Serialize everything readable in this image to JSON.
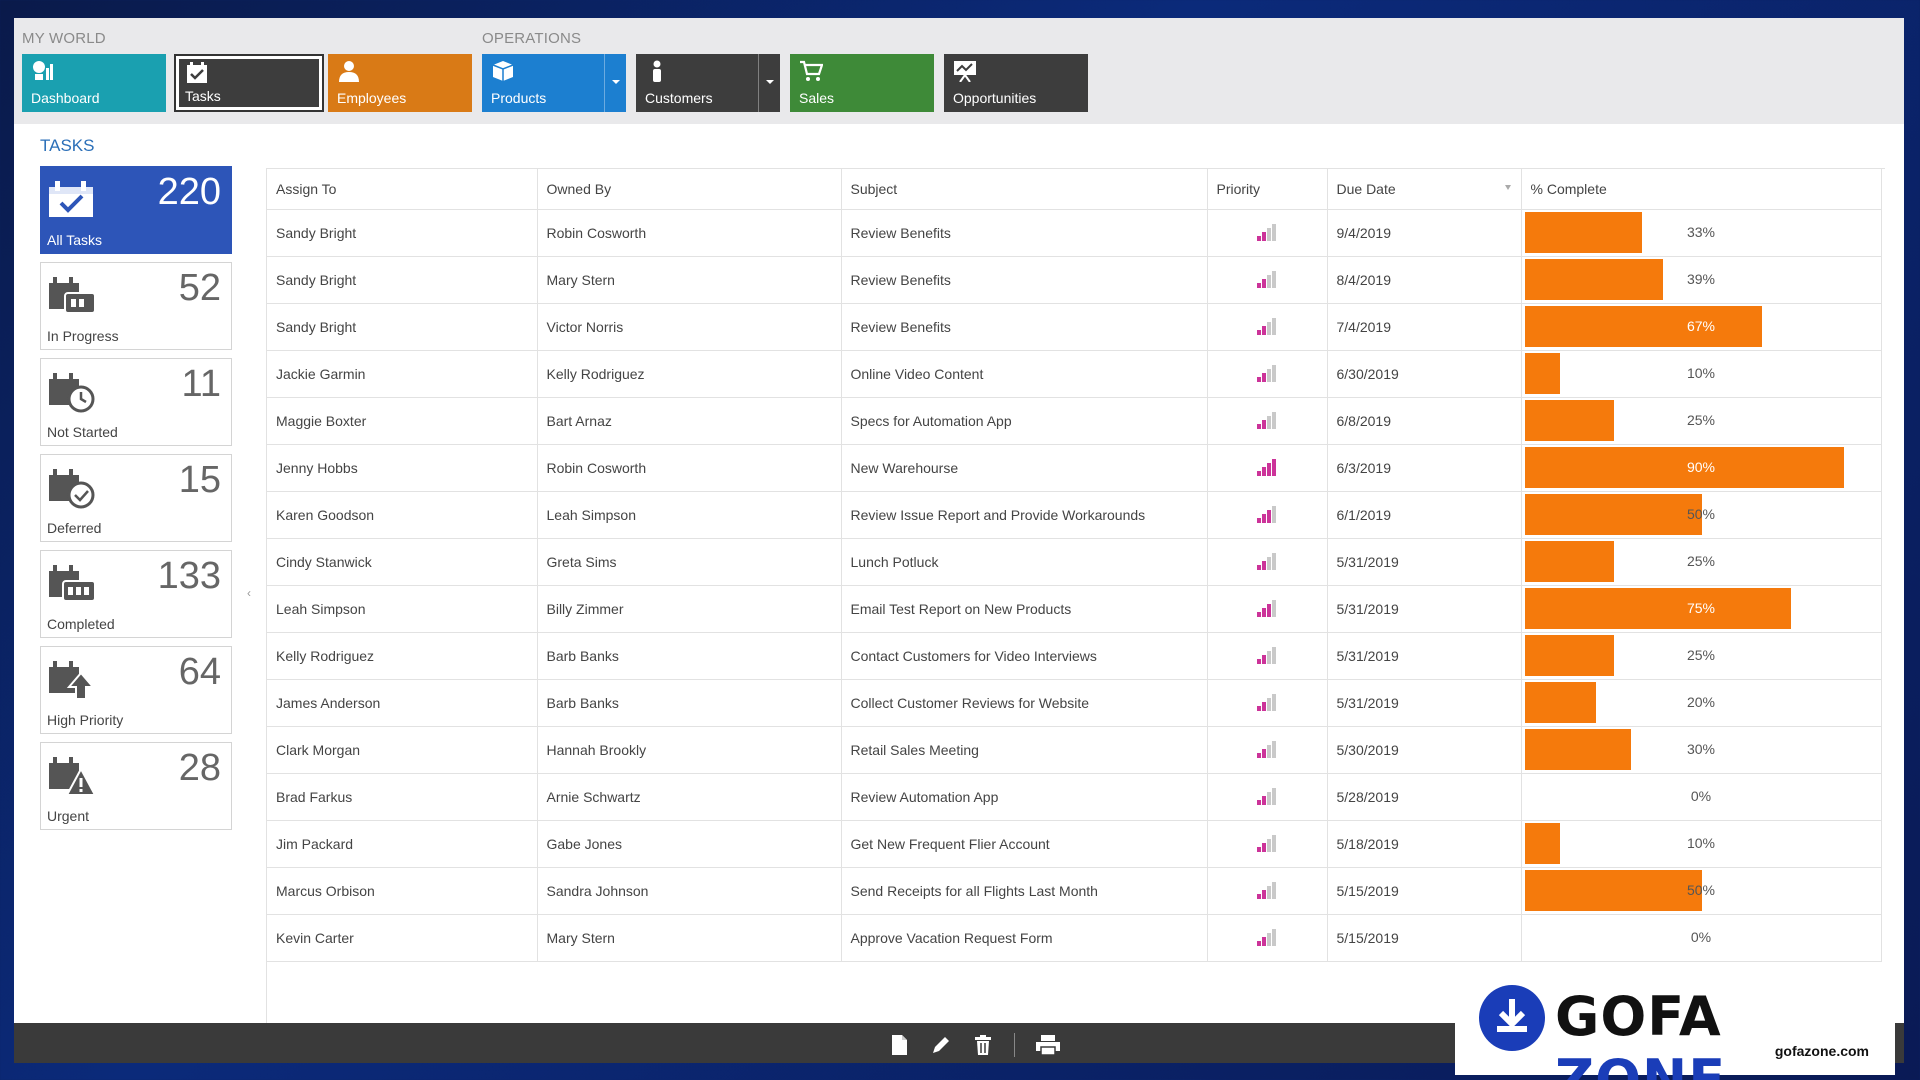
{
  "ribbon": {
    "groups": [
      {
        "label": "MY WORLD"
      },
      {
        "label": "OPERATIONS"
      }
    ],
    "tiles": {
      "dashboard": "Dashboard",
      "tasks": "Tasks",
      "employees": "Employees",
      "products": "Products",
      "customers": "Customers",
      "sales": "Sales",
      "opportunities": "Opportunities"
    }
  },
  "sidebar": {
    "heading": "TASKS",
    "stats": [
      {
        "label": "All Tasks",
        "count": "220",
        "icon": "calendar-check-icon"
      },
      {
        "label": "In Progress",
        "count": "52",
        "icon": "calendar-progress-icon"
      },
      {
        "label": "Not Started",
        "count": "11",
        "icon": "calendar-clock-icon"
      },
      {
        "label": "Deferred",
        "count": "15",
        "icon": "calendar-deferred-icon"
      },
      {
        "label": "Completed",
        "count": "133",
        "icon": "calendar-completed-icon"
      },
      {
        "label": "High Priority",
        "count": "64",
        "icon": "calendar-up-arrow-icon"
      },
      {
        "label": "Urgent",
        "count": "28",
        "icon": "calendar-warning-icon"
      }
    ]
  },
  "grid": {
    "columns": [
      "Assign To",
      "Owned By",
      "Subject",
      "Priority",
      "Due Date",
      "% Complete"
    ],
    "rows": [
      {
        "assign": "Sandy Bright",
        "owner": "Robin Cosworth",
        "subject": "Review Benefits",
        "priority": 2,
        "due": "9/4/2019",
        "pct": 33,
        "pct_label": "33%"
      },
      {
        "assign": "Sandy Bright",
        "owner": "Mary Stern",
        "subject": "Review Benefits",
        "priority": 2,
        "due": "8/4/2019",
        "pct": 39,
        "pct_label": "39%"
      },
      {
        "assign": "Sandy Bright",
        "owner": "Victor Norris",
        "subject": "Review Benefits",
        "priority": 2,
        "due": "7/4/2019",
        "pct": 67,
        "pct_label": "67%"
      },
      {
        "assign": "Jackie Garmin",
        "owner": "Kelly Rodriguez",
        "subject": "Online Video Content",
        "priority": 2,
        "due": "6/30/2019",
        "pct": 10,
        "pct_label": "10%"
      },
      {
        "assign": "Maggie Boxter",
        "owner": "Bart Arnaz",
        "subject": "Specs for Automation App",
        "priority": 2,
        "due": "6/8/2019",
        "pct": 25,
        "pct_label": "25%"
      },
      {
        "assign": "Jenny Hobbs",
        "owner": "Robin Cosworth",
        "subject": "New Warehourse",
        "priority": 4,
        "due": "6/3/2019",
        "pct": 90,
        "pct_label": "90%"
      },
      {
        "assign": "Karen Goodson",
        "owner": "Leah Simpson",
        "subject": "Review Issue Report and Provide Workarounds",
        "priority": 3,
        "due": "6/1/2019",
        "pct": 50,
        "pct_label": "50%"
      },
      {
        "assign": "Cindy Stanwick",
        "owner": "Greta Sims",
        "subject": "Lunch Potluck",
        "priority": 2,
        "due": "5/31/2019",
        "pct": 25,
        "pct_label": "25%"
      },
      {
        "assign": "Leah Simpson",
        "owner": "Billy Zimmer",
        "subject": "Email Test Report on New Products",
        "priority": 3,
        "due": "5/31/2019",
        "pct": 75,
        "pct_label": "75%"
      },
      {
        "assign": "Kelly Rodriguez",
        "owner": "Barb Banks",
        "subject": "Contact Customers for Video Interviews",
        "priority": 2,
        "due": "5/31/2019",
        "pct": 25,
        "pct_label": "25%"
      },
      {
        "assign": "James Anderson",
        "owner": "Barb Banks",
        "subject": "Collect Customer Reviews for Website",
        "priority": 2,
        "due": "5/31/2019",
        "pct": 20,
        "pct_label": "20%"
      },
      {
        "assign": "Clark Morgan",
        "owner": "Hannah Brookly",
        "subject": "Retail Sales Meeting",
        "priority": 2,
        "due": "5/30/2019",
        "pct": 30,
        "pct_label": "30%"
      },
      {
        "assign": "Brad Farkus",
        "owner": "Arnie Schwartz",
        "subject": "Review Automation App",
        "priority": 2,
        "due": "5/28/2019",
        "pct": 0,
        "pct_label": "0%"
      },
      {
        "assign": "Jim Packard",
        "owner": "Gabe Jones",
        "subject": "Get New Frequent Flier Account",
        "priority": 2,
        "due": "5/18/2019",
        "pct": 10,
        "pct_label": "10%"
      },
      {
        "assign": "Marcus Orbison",
        "owner": "Sandra Johnson",
        "subject": "Send Receipts for all Flights Last Month",
        "priority": 2,
        "due": "5/15/2019",
        "pct": 50,
        "pct_label": "50%"
      },
      {
        "assign": "Kevin Carter",
        "owner": "Mary Stern",
        "subject": "Approve Vacation Request Form",
        "priority": 2,
        "due": "5/15/2019",
        "pct": 0,
        "pct_label": "0%"
      }
    ]
  },
  "toolbar": {
    "icons": [
      "new-document-icon",
      "edit-pencil-icon",
      "delete-trash-icon",
      "print-icon"
    ]
  },
  "watermark": {
    "brand_left": "GOFA",
    "brand_right": "ZONE",
    "site": "gofazone.com"
  },
  "colors": {
    "accent_blue": "#2d55b8",
    "bar_orange": "#f57a0c",
    "priority_on": "#cc3399"
  }
}
